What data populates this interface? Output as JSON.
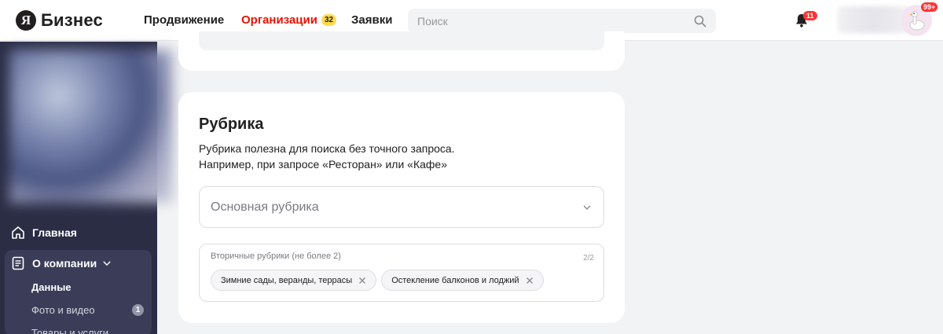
{
  "header": {
    "logo_mark": "Я",
    "logo_text": "Бизнес",
    "nav": [
      {
        "label": "Продвижение",
        "active": false
      },
      {
        "label": "Организации",
        "active": true,
        "badge": "32"
      },
      {
        "label": "Заявки",
        "active": false
      }
    ],
    "search": {
      "placeholder": "Поиск"
    },
    "notifications_badge": "11",
    "avatar_badge": "99+"
  },
  "sidebar": {
    "items": [
      {
        "label": "Главная",
        "icon": "home-icon"
      },
      {
        "label": "О компании",
        "icon": "document-icon"
      }
    ],
    "subitems": [
      {
        "label": "Данные",
        "active": true
      },
      {
        "label": "Фото и видео",
        "count": "1"
      },
      {
        "label": "Товары и услуги"
      }
    ]
  },
  "rubric": {
    "title": "Рубрика",
    "desc_line1": "Рубрика полезна для поиска без точного запроса.",
    "desc_line2": "Например, при запросе «Ресторан» или «Кафе»",
    "main_placeholder": "Основная рубрика",
    "secondary_label": "Вторичные рубрики (не более 2)",
    "secondary_count": "2/2",
    "chips": [
      "Зимние сады, веранды, террасы",
      "Остекление балконов и лоджий"
    ]
  },
  "colors": {
    "accent": "#e61400",
    "sidebar": "#2b2d45",
    "badge": "#ffdb4d"
  }
}
